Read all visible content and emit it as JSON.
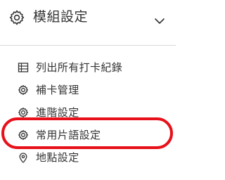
{
  "header": {
    "title": "模組設定",
    "icon": "gear-icon",
    "toggle_icon": "chevron-down-icon"
  },
  "menu": {
    "items": [
      {
        "label": "列出所有打卡紀錄",
        "icon": "table-icon"
      },
      {
        "label": "補卡管理",
        "icon": "gear-icon"
      },
      {
        "label": "進階設定",
        "icon": "gear-icon"
      },
      {
        "label": "常用片語設定",
        "icon": "gear-icon"
      },
      {
        "label": "地點設定",
        "icon": "location-pin-icon"
      }
    ]
  },
  "colors": {
    "text": "#333333",
    "divider": "#d9d9d9",
    "highlight": "#e8101a"
  }
}
